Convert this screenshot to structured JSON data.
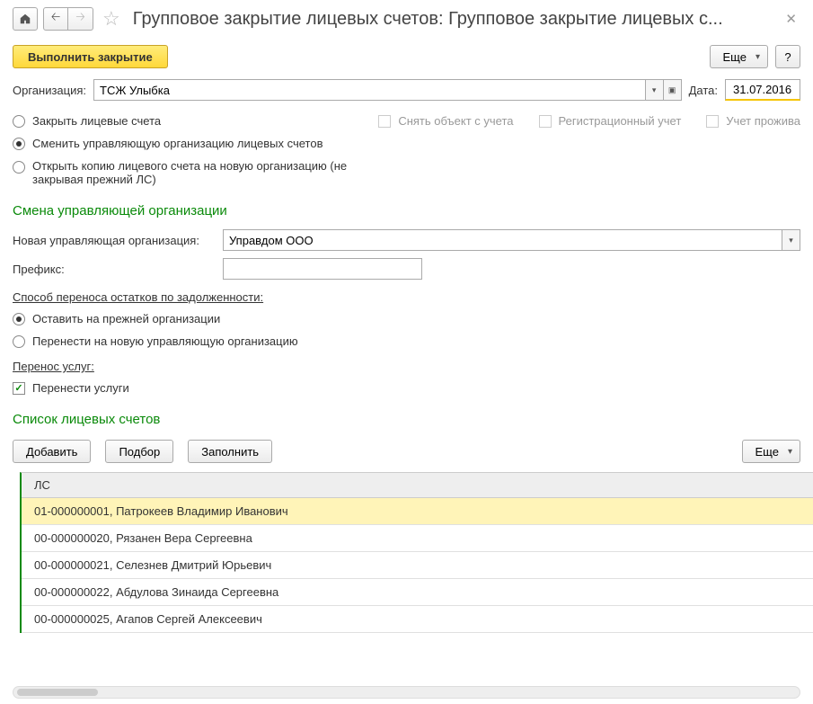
{
  "topbar": {
    "title": "Групповое закрытие лицевых счетов: Групповое закрытие лицевых с..."
  },
  "cmdbar": {
    "primary": "Выполнить закрытие",
    "more": "Еще",
    "help": "?"
  },
  "org": {
    "label": "Организация:",
    "value": "ТСЖ Улыбка",
    "date_label": "Дата:",
    "date_value": "31.07.2016"
  },
  "radios": {
    "opt1": "Закрыть лицевые счета",
    "opt2": "Сменить управляющую организацию лицевых счетов",
    "opt3": "Открыть копию лицевого счета на новую организацию (не закрывая прежний ЛС)"
  },
  "right_checks": {
    "c1": "Снять объект с учета",
    "c2": "Регистрационный учет",
    "c3": "Учет прожива"
  },
  "section1": {
    "title": "Смена управляющей организации",
    "new_org_label": "Новая управляющая организация:",
    "new_org_value": "Управдом ООО",
    "prefix_label": "Префикс:",
    "prefix_value": "",
    "sub1": "Способ переноса остатков по задолженности:",
    "r1": "Оставить на прежней организации",
    "r2": "Перенести на новую управляющую организацию",
    "sub2": "Перенос услуг:",
    "chk1": "Перенести услуги"
  },
  "section2": {
    "title": "Список лицевых счетов",
    "btn_add": "Добавить",
    "btn_pick": "Подбор",
    "btn_fill": "Заполнить",
    "btn_more": "Еще",
    "col_header": "ЛС",
    "rows": [
      "01-000000001, Патрокеев Владимир Иванович",
      "00-000000020, Рязанен Вера Сергеевна",
      "00-000000021, Селезнев Дмитрий Юрьевич",
      "00-000000022, Абдулова Зинаида Сергеевна",
      "00-000000025, Агапов Сергей Алексеевич"
    ]
  }
}
